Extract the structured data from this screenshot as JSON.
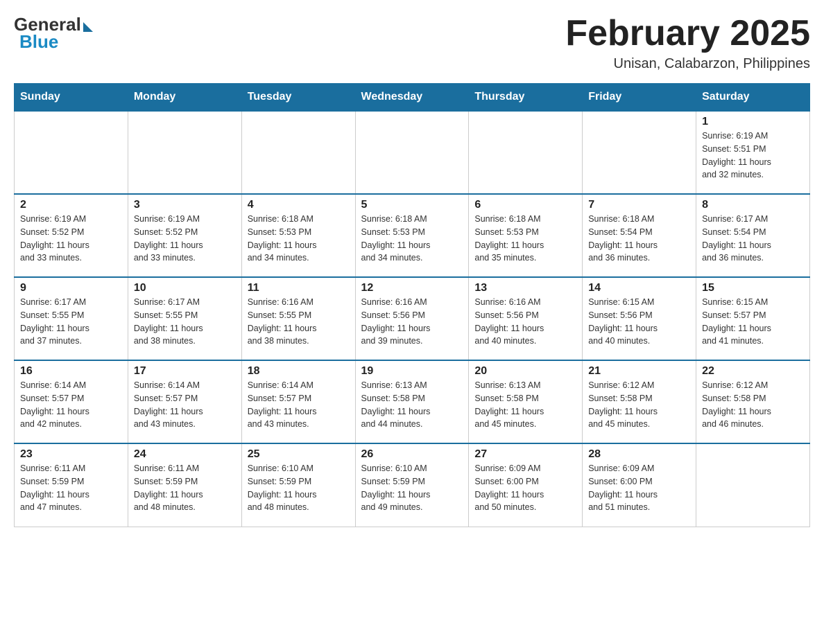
{
  "logo": {
    "general": "General",
    "blue": "Blue"
  },
  "title": "February 2025",
  "location": "Unisan, Calabarzon, Philippines",
  "days_of_week": [
    "Sunday",
    "Monday",
    "Tuesday",
    "Wednesday",
    "Thursday",
    "Friday",
    "Saturday"
  ],
  "weeks": [
    [
      {
        "day": "",
        "info": ""
      },
      {
        "day": "",
        "info": ""
      },
      {
        "day": "",
        "info": ""
      },
      {
        "day": "",
        "info": ""
      },
      {
        "day": "",
        "info": ""
      },
      {
        "day": "",
        "info": ""
      },
      {
        "day": "1",
        "info": "Sunrise: 6:19 AM\nSunset: 5:51 PM\nDaylight: 11 hours\nand 32 minutes."
      }
    ],
    [
      {
        "day": "2",
        "info": "Sunrise: 6:19 AM\nSunset: 5:52 PM\nDaylight: 11 hours\nand 33 minutes."
      },
      {
        "day": "3",
        "info": "Sunrise: 6:19 AM\nSunset: 5:52 PM\nDaylight: 11 hours\nand 33 minutes."
      },
      {
        "day": "4",
        "info": "Sunrise: 6:18 AM\nSunset: 5:53 PM\nDaylight: 11 hours\nand 34 minutes."
      },
      {
        "day": "5",
        "info": "Sunrise: 6:18 AM\nSunset: 5:53 PM\nDaylight: 11 hours\nand 34 minutes."
      },
      {
        "day": "6",
        "info": "Sunrise: 6:18 AM\nSunset: 5:53 PM\nDaylight: 11 hours\nand 35 minutes."
      },
      {
        "day": "7",
        "info": "Sunrise: 6:18 AM\nSunset: 5:54 PM\nDaylight: 11 hours\nand 36 minutes."
      },
      {
        "day": "8",
        "info": "Sunrise: 6:17 AM\nSunset: 5:54 PM\nDaylight: 11 hours\nand 36 minutes."
      }
    ],
    [
      {
        "day": "9",
        "info": "Sunrise: 6:17 AM\nSunset: 5:55 PM\nDaylight: 11 hours\nand 37 minutes."
      },
      {
        "day": "10",
        "info": "Sunrise: 6:17 AM\nSunset: 5:55 PM\nDaylight: 11 hours\nand 38 minutes."
      },
      {
        "day": "11",
        "info": "Sunrise: 6:16 AM\nSunset: 5:55 PM\nDaylight: 11 hours\nand 38 minutes."
      },
      {
        "day": "12",
        "info": "Sunrise: 6:16 AM\nSunset: 5:56 PM\nDaylight: 11 hours\nand 39 minutes."
      },
      {
        "day": "13",
        "info": "Sunrise: 6:16 AM\nSunset: 5:56 PM\nDaylight: 11 hours\nand 40 minutes."
      },
      {
        "day": "14",
        "info": "Sunrise: 6:15 AM\nSunset: 5:56 PM\nDaylight: 11 hours\nand 40 minutes."
      },
      {
        "day": "15",
        "info": "Sunrise: 6:15 AM\nSunset: 5:57 PM\nDaylight: 11 hours\nand 41 minutes."
      }
    ],
    [
      {
        "day": "16",
        "info": "Sunrise: 6:14 AM\nSunset: 5:57 PM\nDaylight: 11 hours\nand 42 minutes."
      },
      {
        "day": "17",
        "info": "Sunrise: 6:14 AM\nSunset: 5:57 PM\nDaylight: 11 hours\nand 43 minutes."
      },
      {
        "day": "18",
        "info": "Sunrise: 6:14 AM\nSunset: 5:57 PM\nDaylight: 11 hours\nand 43 minutes."
      },
      {
        "day": "19",
        "info": "Sunrise: 6:13 AM\nSunset: 5:58 PM\nDaylight: 11 hours\nand 44 minutes."
      },
      {
        "day": "20",
        "info": "Sunrise: 6:13 AM\nSunset: 5:58 PM\nDaylight: 11 hours\nand 45 minutes."
      },
      {
        "day": "21",
        "info": "Sunrise: 6:12 AM\nSunset: 5:58 PM\nDaylight: 11 hours\nand 45 minutes."
      },
      {
        "day": "22",
        "info": "Sunrise: 6:12 AM\nSunset: 5:58 PM\nDaylight: 11 hours\nand 46 minutes."
      }
    ],
    [
      {
        "day": "23",
        "info": "Sunrise: 6:11 AM\nSunset: 5:59 PM\nDaylight: 11 hours\nand 47 minutes."
      },
      {
        "day": "24",
        "info": "Sunrise: 6:11 AM\nSunset: 5:59 PM\nDaylight: 11 hours\nand 48 minutes."
      },
      {
        "day": "25",
        "info": "Sunrise: 6:10 AM\nSunset: 5:59 PM\nDaylight: 11 hours\nand 48 minutes."
      },
      {
        "day": "26",
        "info": "Sunrise: 6:10 AM\nSunset: 5:59 PM\nDaylight: 11 hours\nand 49 minutes."
      },
      {
        "day": "27",
        "info": "Sunrise: 6:09 AM\nSunset: 6:00 PM\nDaylight: 11 hours\nand 50 minutes."
      },
      {
        "day": "28",
        "info": "Sunrise: 6:09 AM\nSunset: 6:00 PM\nDaylight: 11 hours\nand 51 minutes."
      },
      {
        "day": "",
        "info": ""
      }
    ]
  ]
}
